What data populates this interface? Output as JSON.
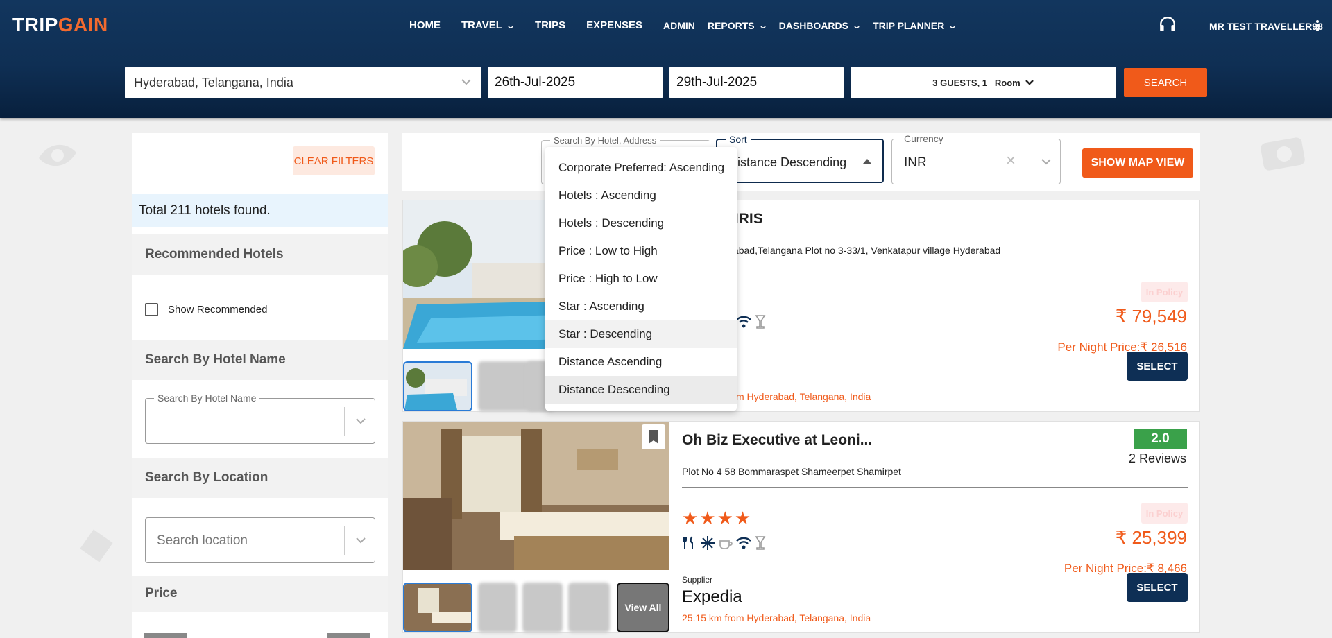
{
  "brand": {
    "trip": "TRIP",
    "gain": "GAIN"
  },
  "nav": [
    {
      "label": "HOME",
      "has_menu": false
    },
    {
      "label": "TRAVEL",
      "has_menu": true
    },
    {
      "label": "TRIPS",
      "has_menu": false
    },
    {
      "label": "EXPENSES",
      "has_menu": false
    },
    {
      "label": "ADMIN",
      "has_menu": false
    },
    {
      "label": "REPORTS",
      "has_menu": true
    },
    {
      "label": "DASHBOARDS",
      "has_menu": true
    },
    {
      "label": "TRIP PLANNER",
      "has_menu": true
    }
  ],
  "user": {
    "name": "MR TEST TRAVELLER98",
    "support_icon": "headphones-icon"
  },
  "search": {
    "location": "Hyderabad, Telangana, India",
    "checkin": "26th-Jul-2025",
    "checkout": "29th-Jul-2025",
    "guests": "3 GUESTS, 1",
    "room_label": "Room",
    "button": "SEARCH"
  },
  "sidebar": {
    "clear_filters": "CLEAR FILTERS",
    "total": "Total 211 hotels found.",
    "recommended_title": "Recommended Hotels",
    "show_recommended": "Show Recommended",
    "by_name_title": "Search By Hotel Name",
    "by_name_legend": "Search By Hotel Name",
    "by_location_title": "Search By Location",
    "by_location_placeholder": "Search location",
    "price_title": "Price"
  },
  "toolbar": {
    "hotel_search_legend": "Search By Hotel, Address",
    "sort_legend": "Sort",
    "sort_value": "Distance Descending",
    "currency_legend": "Currency",
    "currency_value": "INR",
    "map_button": "SHOW MAP VIEW"
  },
  "sort_options": [
    "Corporate Preferred: Ascending",
    "Hotels : Ascending",
    "Hotels : Descending",
    "Price : Low to High",
    "Price : High to Low",
    "Star : Ascending",
    "Star : Descending",
    "Distance Ascending",
    "Distance Descending"
  ],
  "hotels": [
    {
      "name": "m Stay-IRIS",
      "address": "village,Moinabad,Telangana Plot no 3-33/1, Venkatapur village Hyderabad",
      "policy": "In Policy",
      "price": "₹ 79,549",
      "per_night": "Per Night Price:₹ 26,516",
      "distance": "m Hyderabad, Telangana, India",
      "select": "SELECT"
    },
    {
      "name": "Oh Biz Executive at Leoni...",
      "address": "Plot No 4 58 Bommaraspet Shameerpet Shamirpet",
      "rating": "2.0",
      "reviews": "2 Reviews",
      "stars": "★★★★",
      "policy": "In Policy",
      "price": "₹ 25,399",
      "per_night": "Per Night Price:₹ 8,466",
      "supplier_label": "Supplier",
      "supplier": "Expedia",
      "distance": "25.15 km from Hyderabad, Telangana, India",
      "view_all": "View All",
      "select": "SELECT"
    }
  ],
  "colors": {
    "brand_orange": "#f05a1a",
    "header_navy": "#0f2f54",
    "rating_green": "#3aa14a"
  }
}
